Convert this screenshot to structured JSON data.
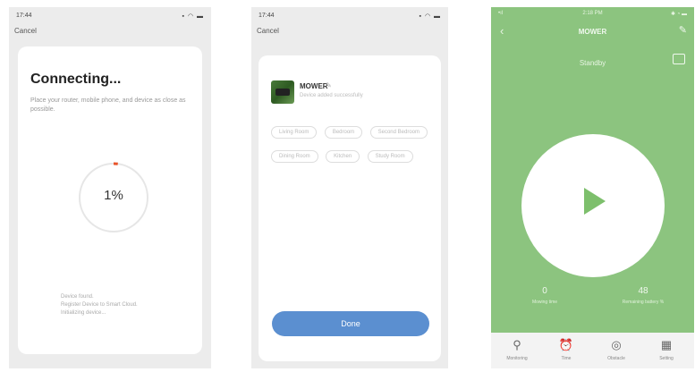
{
  "screen1": {
    "time": "17:44",
    "status_icons": "▪ ◠ ▬",
    "cancel_label": "Cancel",
    "title": "Connecting...",
    "description": "Place your router, mobile phone, and device as close as possible.",
    "progress_label": "1%",
    "progress_fraction": 0.01,
    "steps": [
      "Device found.",
      "Register Device to Smart Cloud.",
      "Initializing device..."
    ],
    "accent_color": "#e8542a"
  },
  "screen2": {
    "time": "17:44",
    "status_icons": "▪ ◠ ▬",
    "cancel_label": "Cancel",
    "device_name": "MOWER",
    "device_subtitle": "Device added successfully",
    "rooms": [
      "Living Room",
      "Bedroom",
      "Second Bedroom",
      "Dining Room",
      "Kitchen",
      "Study Room"
    ],
    "done_label": "Done",
    "accent_color": "#5b8fd0"
  },
  "screen3": {
    "status_left": "•ıl",
    "status_center": "2:18 PM",
    "status_right": "✱ ◔ ▬",
    "title": "MOWER",
    "status_text": "Standby",
    "stats": [
      {
        "value": "0",
        "label": "Mowing time"
      },
      {
        "value": "48",
        "label": "Remaining battery %"
      }
    ],
    "tabs": [
      {
        "label": "Monitoring",
        "icon": "mower-icon"
      },
      {
        "label": "Time",
        "icon": "alarm-clock-icon"
      },
      {
        "label": "Obstacle",
        "icon": "shield-icon"
      },
      {
        "label": "Setting",
        "icon": "grid-icon"
      }
    ],
    "accent_color": "#8cc47f"
  }
}
